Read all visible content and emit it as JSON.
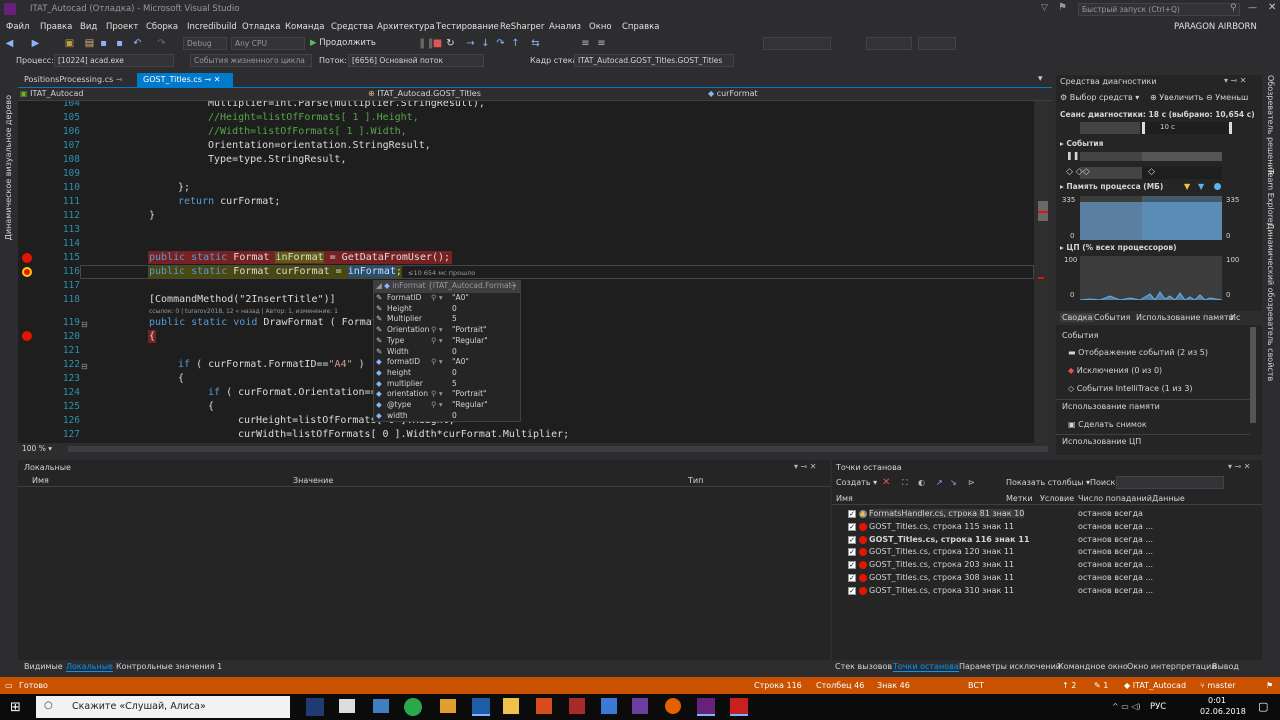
{
  "window": {
    "title": "ITAT_Autocad (Отладка) - Microsoft Visual Studio",
    "quick_launch": "Быстрый запуск (Ctrl+Q)",
    "user": "PARAGON AIRBORN",
    "avatar": "PA"
  },
  "menu": [
    "Файл",
    "Правка",
    "Вид",
    "Проект",
    "Сборка",
    "Incredibuild",
    "Отладка",
    "Команда",
    "Средства",
    "Архитектура",
    "Тестирование",
    "ReSharper",
    "Анализ",
    "Окно",
    "Справка"
  ],
  "toolbar": {
    "config": "Debug",
    "platform": "Any CPU",
    "continue": "Продолжить"
  },
  "toolbar2": {
    "process_label": "Процесс:",
    "process_value": "[10224] acad.exe",
    "lifecycle": "События жизненного цикла",
    "thread_label": "Поток:",
    "thread_value": "[6656] Основной поток",
    "stack_label": "Кадр стека:",
    "stack_value": "ITAT_Autocad.GOST_Titles.GOST_Titles"
  },
  "left_rail": {
    "text": "Динамическое визуальное дерево"
  },
  "right_rail": [
    "Обозреватель решений",
    "Team Explorer",
    "Динамический обозреватель свойств"
  ],
  "doc_tabs": [
    {
      "label": "PositionsProcessing.cs",
      "active": false
    },
    {
      "label": "GOST_Titles.cs",
      "active": true
    }
  ],
  "nav": {
    "project": "ITAT_Autocad",
    "class": "ITAT_Autocad.GOST_Titles",
    "member": "curFormat"
  },
  "code": {
    "lines": [
      "104",
      "105",
      "106",
      "107",
      "108",
      "109",
      "110",
      "111",
      "112",
      "113",
      "114",
      "115",
      "116",
      "117",
      "118",
      "119",
      "120",
      "121",
      "122",
      "123",
      "124",
      "125",
      "126",
      "127"
    ],
    "l104": "Multiplier=int.Parse(multiplier.StringResult),",
    "l105": "//Height=listOfFormats[ 1 ].Height,",
    "l106": "//Width=listOfFormats[ 1 ].Width,",
    "l107": "Orientation=orientation.StringResult,",
    "l108": "Type=type.StringResult,",
    "l110": "};",
    "l111a": "return",
    "l111b": " curFormat;",
    "l112": "}",
    "l115a": "public static",
    "l115b": " Format ",
    "l115c": "inFormat",
    "l115d": " = GetDataFromUser();",
    "l116a": "public static",
    "l116b": " Format curFormat = ",
    "l116c": "inFormat",
    "l116d": ";",
    "l116_timing": "≤10 654 мс прошло",
    "l118": "[CommandMethod(\"2InsertTitle\")]",
    "codelens": "ссылок: 0 | turarov2018, 12 « назад | Автор: 1, изменение: 1",
    "l119a": "public static void",
    "l119b": " DrawFormat ( Format",
    "l120": "{",
    "l122a": "if",
    "l122b": " ( curFormat.FormatID==",
    "l122c": "\"A4\"",
    "l122d": " )",
    "l123": "{",
    "l124a": "if",
    "l124b": " ( curFormat.Orientation==",
    "l125": "{",
    "l126": "curHeight=listOfFormats[ 0 ].Height;",
    "l127": "curWidth=listOfFormats[ 0 ].Width*curFormat.Multiplier;"
  },
  "datatip": {
    "header": "inFormat {ITAT_Autocad.Format}",
    "rows": [
      {
        "name": "FormatID",
        "value": "\"A0\"",
        "search": true
      },
      {
        "name": "Height",
        "value": "0",
        "search": false
      },
      {
        "name": "Multiplier",
        "value": "5",
        "search": false
      },
      {
        "name": "Orientation",
        "value": "\"Portrait\"",
        "search": true
      },
      {
        "name": "Type",
        "value": "\"Regular\"",
        "search": true
      },
      {
        "name": "Width",
        "value": "0",
        "search": false
      },
      {
        "name": "formatID",
        "value": "\"A0\"",
        "search": true
      },
      {
        "name": "height",
        "value": "0",
        "search": false
      },
      {
        "name": "multiplier",
        "value": "5",
        "search": false
      },
      {
        "name": "orientation",
        "value": "\"Portrait\"",
        "search": true
      },
      {
        "name": "@type",
        "value": "\"Regular\"",
        "search": true
      },
      {
        "name": "width",
        "value": "0",
        "search": false
      }
    ]
  },
  "zoom": "100 %",
  "diagnostics": {
    "title": "Средства диагностики",
    "select_tools": "Выбор средств",
    "zoom_in": "Увеличить",
    "zoom_out": "Уменьш",
    "session": "Сеанс диагностики: 18 с (выбрано: 10,654 с)",
    "ruler_label": "10 с",
    "events": "События",
    "memory": "Память процесса (МБ)",
    "mem_max": "335",
    "mem_min": "0",
    "cpu": "ЦП (% всех процессоров)",
    "cpu_max": "100",
    "cpu_min": "0",
    "tabs": [
      "Сводка",
      "События",
      "Использование памяти",
      "Ис"
    ],
    "sec_events": "События",
    "show_events": "Отображение событий (2 из 5)",
    "exceptions": "Исключения (0 из 0)",
    "intellitrace": "События IntelliTrace (1 из 3)",
    "sec_memory": "Использование памяти",
    "snapshot": "Сделать снимок",
    "sec_cpu": "Использование ЦП"
  },
  "locals": {
    "title": "Локальные",
    "col_name": "Имя",
    "col_value": "Значение",
    "col_type": "Тип"
  },
  "breakpoints": {
    "title": "Точки останова",
    "create": "Создать",
    "show_columns": "Показать столбцы",
    "search": "Поиск:",
    "cols": [
      "Имя",
      "Метки",
      "Условие",
      "Число попаданий",
      "Данные"
    ],
    "rows": [
      {
        "name": "FormatsHandler.cs, строка 81 знак 10",
        "hit": "останов всегда",
        "warn": true,
        "bold": false
      },
      {
        "name": "GOST_Titles.cs, строка 115 знак 11",
        "hit": "останов всегда ...",
        "warn": false,
        "bold": false
      },
      {
        "name": "GOST_Titles.cs, строка 116 знак 11",
        "hit": "останов всегда ...",
        "warn": false,
        "bold": true
      },
      {
        "name": "GOST_Titles.cs, строка 120 знак 11",
        "hit": "останов всегда ...",
        "warn": false,
        "bold": false
      },
      {
        "name": "GOST_Titles.cs, строка 203 знак 11",
        "hit": "останов всегда ...",
        "warn": false,
        "bold": false
      },
      {
        "name": "GOST_Titles.cs, строка 308 знак 11",
        "hit": "останов всегда ...",
        "warn": false,
        "bold": false
      },
      {
        "name": "GOST_Titles.cs, строка 310 знак 11",
        "hit": "останов всегда ...",
        "warn": false,
        "bold": false
      }
    ]
  },
  "bottom_tabs_left": [
    "Видимые",
    "Локальные",
    "Контрольные значения 1"
  ],
  "bottom_tabs_right": [
    "Стек вызовов",
    "Точки останова",
    "Параметры исключений",
    "Командное окно",
    "Окно интерпретации",
    "Вывод"
  ],
  "status": {
    "ready": "Готово",
    "line": "Строка 116",
    "col": "Столбец 46",
    "ch": "Знак 46",
    "ins": "ВСТ",
    "up": "2",
    "pen": "1",
    "project": "ITAT_Autocad",
    "branch": "master"
  },
  "taskbar": {
    "search": "Скажите «Слушай, Алиса»",
    "lang": "РУС",
    "time": "0:01",
    "date": "02.06.2018"
  }
}
